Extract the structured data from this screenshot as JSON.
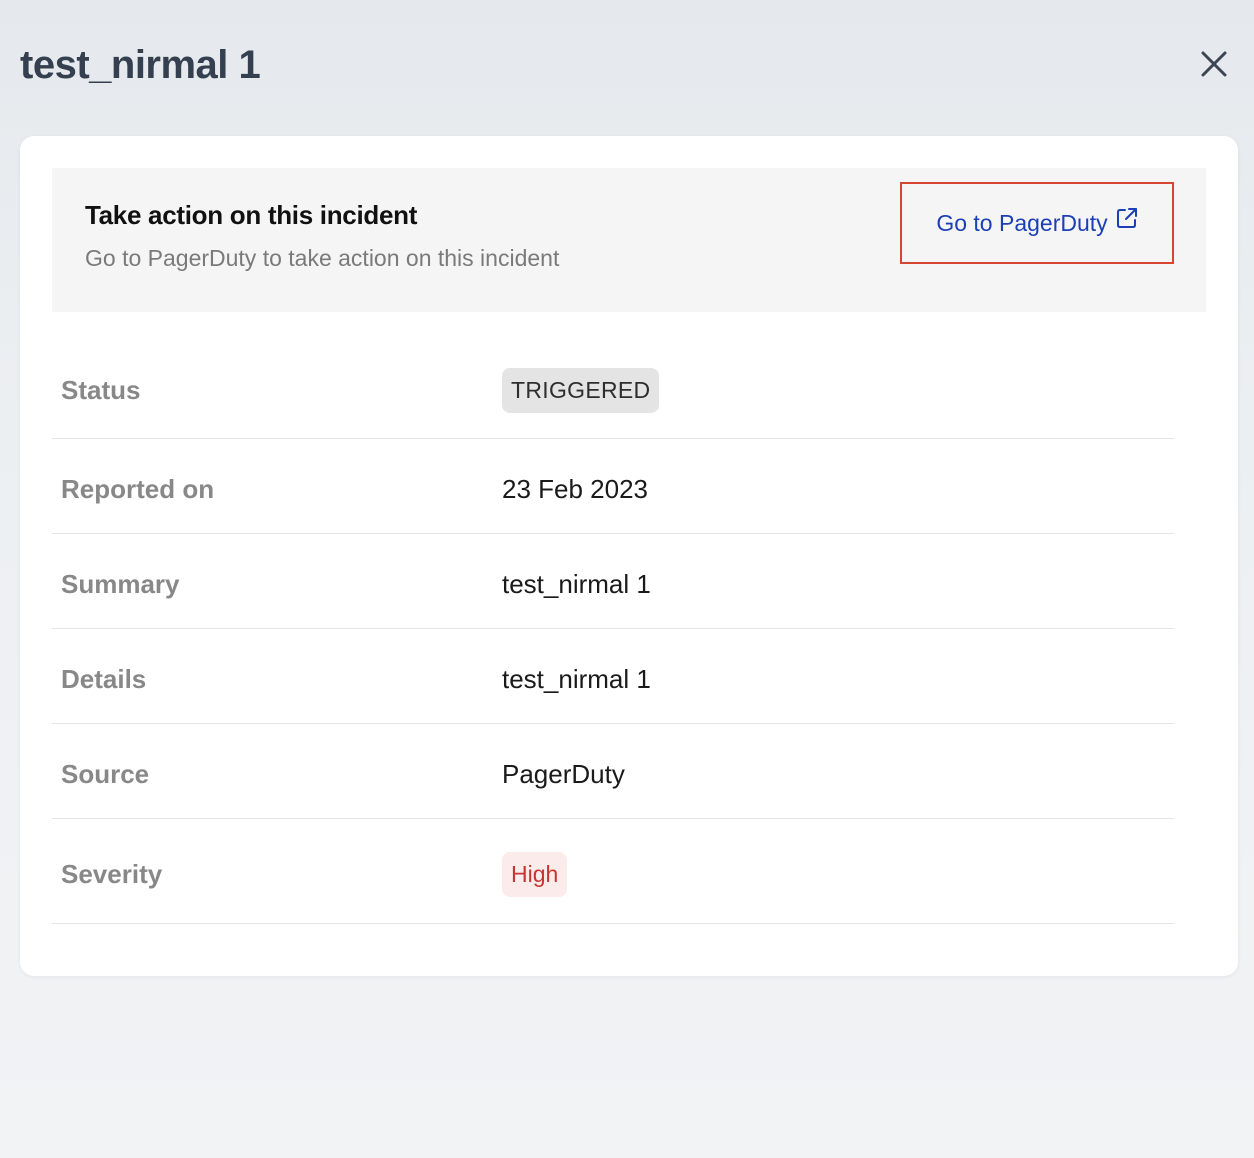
{
  "header": {
    "title": "test_nirmal 1"
  },
  "action_panel": {
    "title": "Take action on this incident",
    "subtitle": "Go to PagerDuty to take action on this incident",
    "link_label": "Go to PagerDuty",
    "link_icon": "external-link-icon"
  },
  "details": {
    "status": {
      "label": "Status",
      "value": "TRIGGERED"
    },
    "reported_on": {
      "label": "Reported on",
      "value": "23 Feb 2023"
    },
    "summary": {
      "label": "Summary",
      "value": "test_nirmal 1"
    },
    "details": {
      "label": "Details",
      "value": "test_nirmal 1"
    },
    "source": {
      "label": "Source",
      "value": "PagerDuty"
    },
    "severity": {
      "label": "Severity",
      "value": "High"
    }
  },
  "colors": {
    "link": "#1c3fb5",
    "highlight_border": "#d6452f",
    "severity_text": "#c7352f",
    "severity_bg": "#fcebeb",
    "status_bg": "#e4e4e4"
  }
}
